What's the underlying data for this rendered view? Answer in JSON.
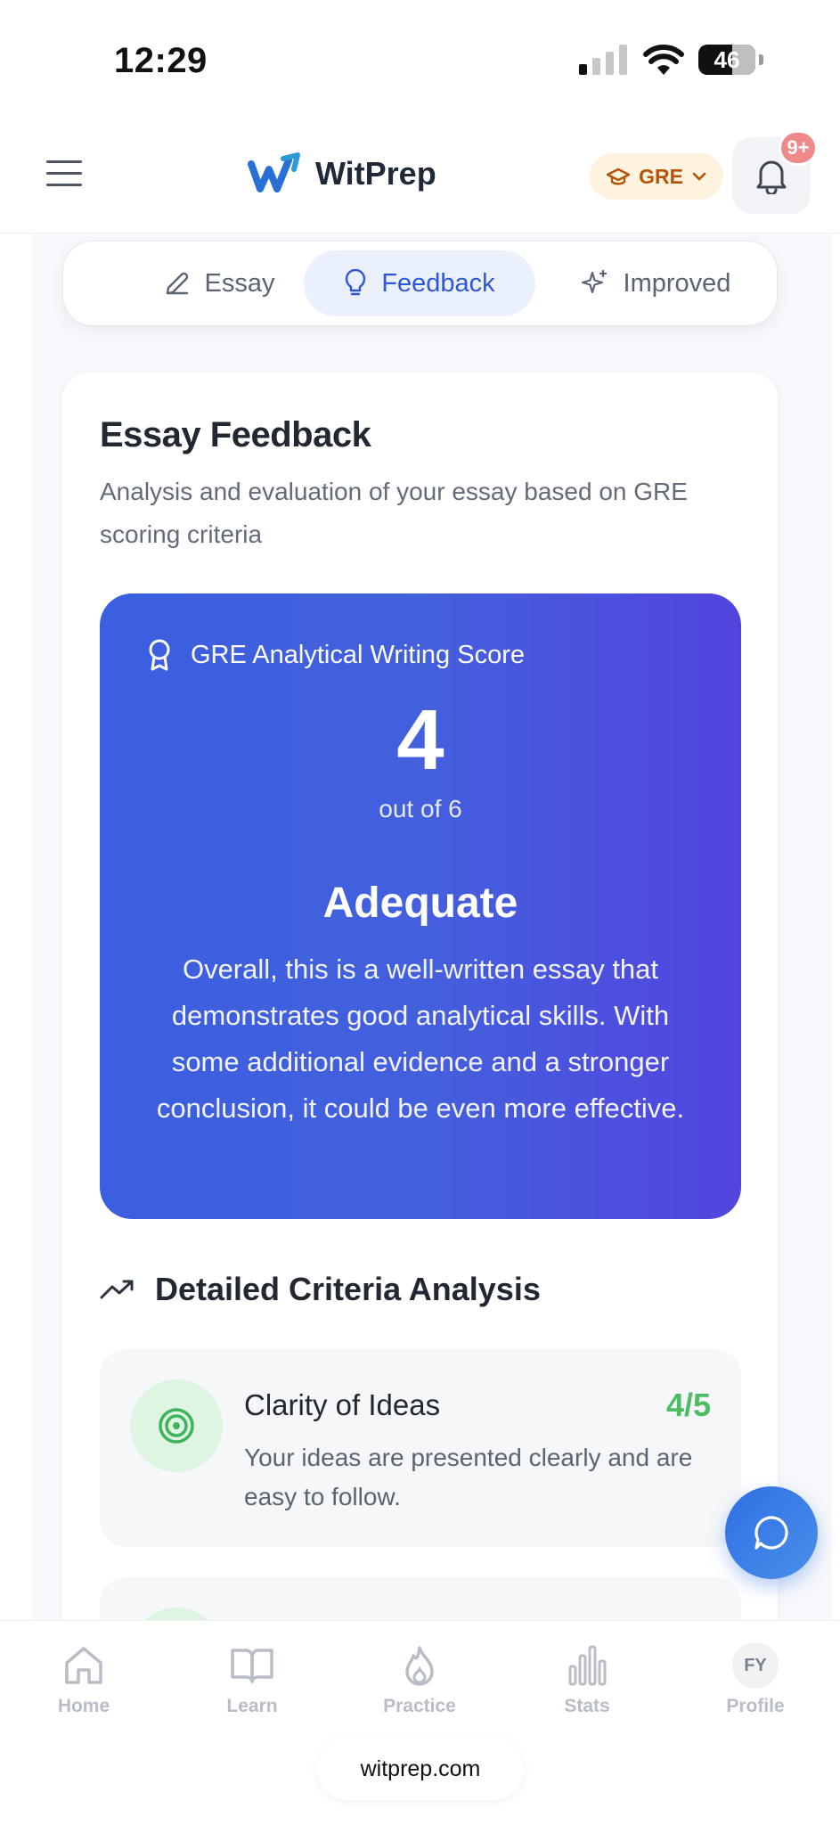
{
  "status": {
    "time": "12:29",
    "battery": "46"
  },
  "header": {
    "brand": "WitPrep",
    "exam": "GRE",
    "notifications": "9+"
  },
  "tabs": [
    {
      "label": "Essay"
    },
    {
      "label": "Feedback"
    },
    {
      "label": "Improved"
    }
  ],
  "feedback": {
    "title": "Essay Feedback",
    "subtitle": "Analysis and evaluation of your essay based on GRE scoring criteria",
    "score_label": "GRE Analytical Writing Score",
    "score": "4",
    "out_of": "out of 6",
    "level": "Adequate",
    "summary": "Overall, this is a well-written essay that demonstrates good analytical skills. With some additional evidence and a stronger conclusion, it could be even more effective."
  },
  "criteria": {
    "heading": "Detailed Criteria Analysis",
    "items": [
      {
        "name": "Clarity of Ideas",
        "score": "4/5",
        "description": "Your ideas are presented clearly and are easy to follow."
      }
    ]
  },
  "nav": [
    {
      "label": "Home"
    },
    {
      "label": "Learn"
    },
    {
      "label": "Practice"
    },
    {
      "label": "Stats"
    },
    {
      "label": "Profile",
      "initials": "FY"
    }
  ],
  "browser": {
    "url": "witprep.com"
  },
  "colors": {
    "primary": "#3a5fe0",
    "accent_green": "#4dbd63",
    "badge": "#f08a8a",
    "exam_chip": "#b45309"
  }
}
